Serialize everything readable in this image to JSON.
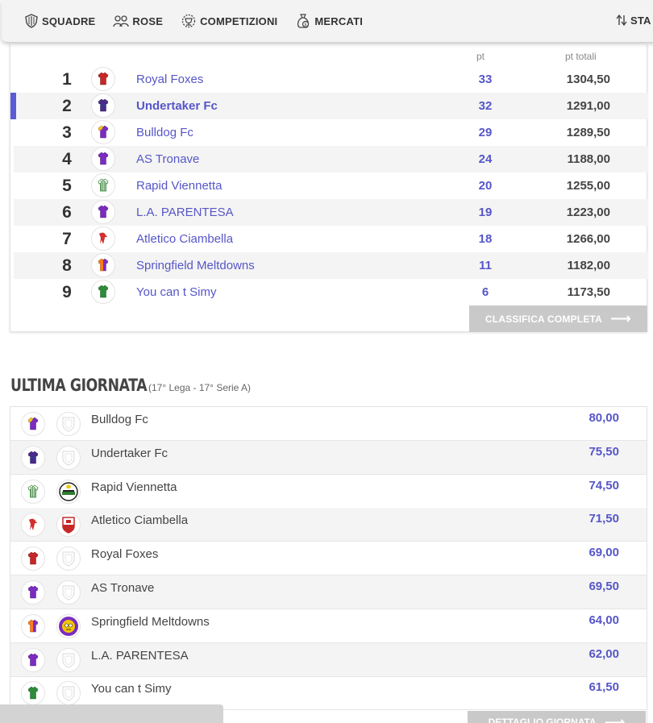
{
  "nav": {
    "items": [
      {
        "label": "SQUADRE",
        "icon": "shield-icon"
      },
      {
        "label": "ROSE",
        "icon": "people-icon"
      },
      {
        "label": "COMPETIZIONI",
        "icon": "trophy-icon"
      },
      {
        "label": "MERCATI",
        "icon": "money-bag-icon"
      }
    ],
    "right_label": "STA"
  },
  "standings": {
    "col_pt": "pt",
    "col_pt_total": "pt totali",
    "rows": [
      {
        "rank": "1",
        "team": "Royal Foxes",
        "pt": "33",
        "total": "1304,50",
        "jersey": "red"
      },
      {
        "rank": "2",
        "team": "Undertaker Fc",
        "pt": "32",
        "total": "1291,00",
        "jersey": "purple-navy",
        "highlighted": true
      },
      {
        "rank": "3",
        "team": "Bulldog Fc",
        "pt": "29",
        "total": "1289,50",
        "jersey": "purple-yellow"
      },
      {
        "rank": "4",
        "team": "AS Tronave",
        "pt": "24",
        "total": "1188,00",
        "jersey": "purple"
      },
      {
        "rank": "5",
        "team": "Rapid Viennetta",
        "pt": "20",
        "total": "1255,00",
        "jersey": "green-white-stripes"
      },
      {
        "rank": "6",
        "team": "L.A. PARENTESA",
        "pt": "19",
        "total": "1223,00",
        "jersey": "purple"
      },
      {
        "rank": "7",
        "team": "Atletico Ciambella",
        "pt": "18",
        "total": "1266,00",
        "jersey": "red-white-logo"
      },
      {
        "rank": "8",
        "team": "Springfield Meltdowns",
        "pt": "11",
        "total": "1182,00",
        "jersey": "orange-purple"
      },
      {
        "rank": "9",
        "team": "You can t Simy",
        "pt": "6",
        "total": "1173,50",
        "jersey": "green"
      }
    ],
    "full_button": "CLASSIFICA COMPLETA"
  },
  "last_round": {
    "title": "ULTIMA GIORNATA",
    "subtitle": "(17° Lega - 17° Serie A)",
    "rows": [
      {
        "team": "Bulldog Fc",
        "score": "80,00",
        "jersey": "purple-yellow",
        "badge": "empty"
      },
      {
        "team": "Undertaker Fc",
        "score": "75,50",
        "jersey": "purple-navy",
        "badge": "empty"
      },
      {
        "team": "Rapid Viennetta",
        "score": "74,50",
        "jersey": "green-white-stripes",
        "badge": "rapid-crest"
      },
      {
        "team": "Atletico Ciambella",
        "score": "71,50",
        "jersey": "red-white-logo",
        "badge": "red-crest"
      },
      {
        "team": "Royal Foxes",
        "score": "69,00",
        "jersey": "red",
        "badge": "empty"
      },
      {
        "team": "AS Tronave",
        "score": "69,50",
        "jersey": "purple",
        "badge": "empty"
      },
      {
        "team": "Springfield Meltdowns",
        "score": "64,00",
        "jersey": "orange-purple",
        "badge": "springfield-crest"
      },
      {
        "team": "L.A. PARENTESA",
        "score": "62,00",
        "jersey": "purple",
        "badge": "empty"
      },
      {
        "team": "You can t Simy",
        "score": "61,50",
        "jersey": "green",
        "badge": "empty"
      }
    ],
    "detail_button": "DETTAGLIO GIORNATA"
  },
  "colors": {
    "accent": "#5656c8",
    "button_gray": "#c9c9c9",
    "row_alt": "#f4f4f4"
  }
}
